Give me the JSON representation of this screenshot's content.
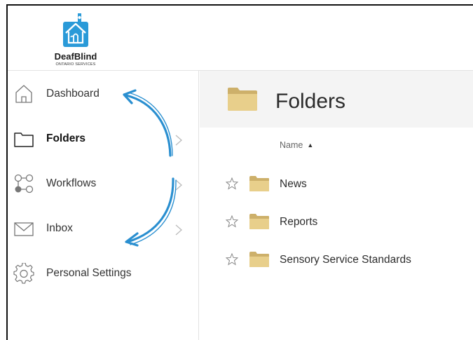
{
  "brand": {
    "name": "DeafBlind",
    "subtitle": "ONTARIO SERVICES",
    "accent_color": "#2a9ad8"
  },
  "sidebar": {
    "items": [
      {
        "label": "Dashboard",
        "icon": "home-icon",
        "active": false,
        "has_chevron": false
      },
      {
        "label": "Folders",
        "icon": "folder-outline-icon",
        "active": true,
        "has_chevron": true
      },
      {
        "label": "Workflows",
        "icon": "workflow-icon",
        "active": false,
        "has_chevron": true
      },
      {
        "label": "Inbox",
        "icon": "envelope-icon",
        "active": false,
        "has_chevron": true
      },
      {
        "label": "Personal Settings",
        "icon": "gear-icon",
        "active": false,
        "has_chevron": false
      }
    ]
  },
  "main": {
    "title": "Folders",
    "title_icon": "folder-icon",
    "column_name": "Name",
    "sort_indicator": "▲",
    "rows": [
      {
        "label": "News",
        "icon": "folder-icon",
        "star": "star-outline-icon"
      },
      {
        "label": "Reports",
        "icon": "folder-icon",
        "star": "star-outline-icon"
      },
      {
        "label": "Sensory Service Standards",
        "icon": "folder-icon",
        "star": "star-outline-icon"
      }
    ]
  },
  "annotation": {
    "arrow_color": "#2a8fd0",
    "description_icon": "curved-arrows-icon"
  },
  "colors": {
    "folder_fill": "#e8cf8b",
    "folder_shade": "#cdb06a",
    "title_bar": "#f4f4f4"
  }
}
